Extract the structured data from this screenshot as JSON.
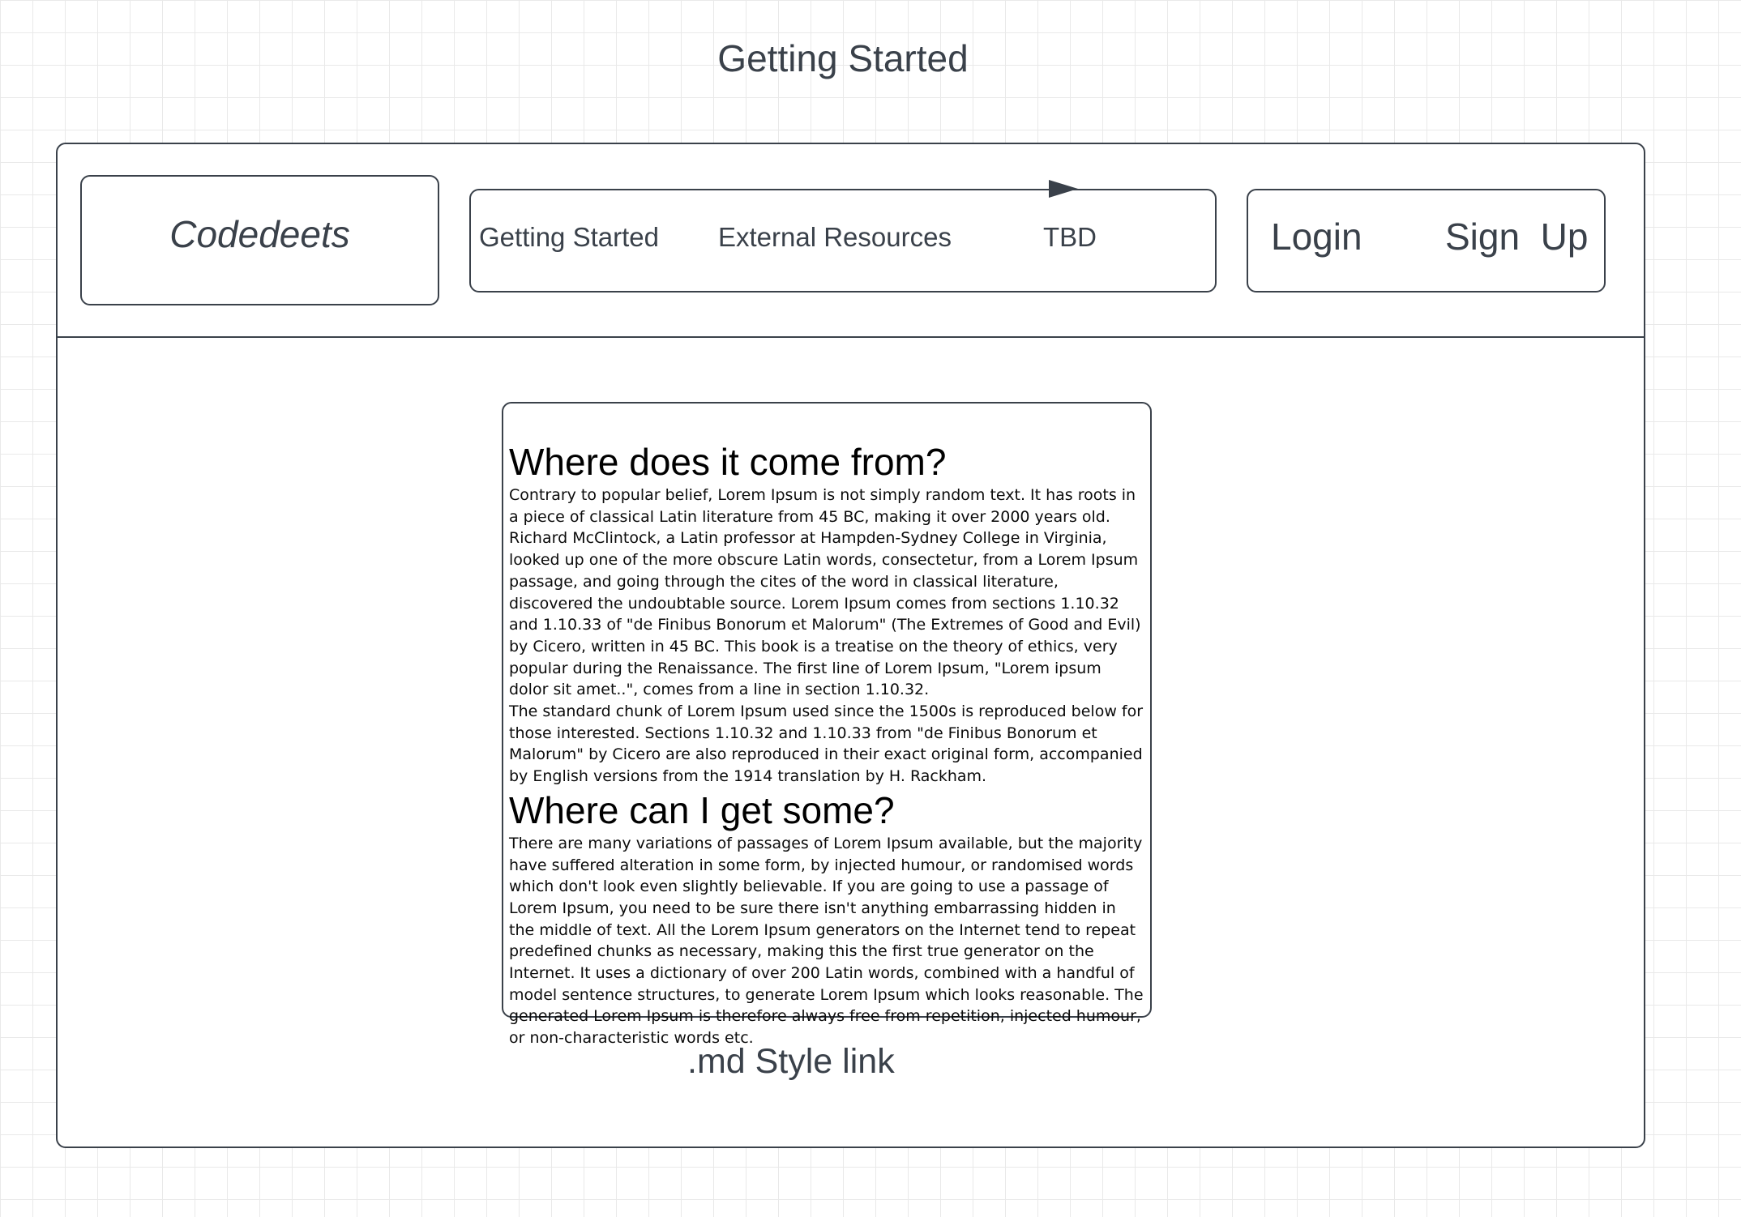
{
  "page_title": "Getting Started",
  "header": {
    "logo": "Codedeets",
    "nav": {
      "items": [
        "Getting Started",
        "External Resources",
        "TBD"
      ]
    },
    "auth": {
      "login": "Login",
      "signup": "Sign  Up"
    }
  },
  "content": {
    "sections": [
      {
        "heading": "Where does it come from?",
        "paragraphs": [
          "Contrary to popular belief, Lorem Ipsum is not simply random text. It has roots in a piece of classical Latin literature from 45 BC, making it over 2000 years old. Richard McClintock, a Latin professor at Hampden-Sydney College in Virginia, looked up one of the more obscure Latin words, consectetur, from a Lorem Ipsum passage, and going through the cites of the word in classical literature, discovered the undoubtable source. Lorem Ipsum comes from sections 1.10.32 and 1.10.33 of \"de Finibus Bonorum et Malorum\" (The Extremes of Good and Evil) by Cicero, written in 45 BC. This book is a treatise on the theory of ethics, very popular during the Renaissance. The first line of Lorem Ipsum, \"Lorem ipsum dolor sit amet..\", comes from a line in section 1.10.32.",
          "The standard chunk of Lorem Ipsum used since the 1500s is reproduced below for those interested. Sections 1.10.32 and 1.10.33 from \"de Finibus Bonorum et Malorum\" by Cicero are also reproduced in their exact original form, accompanied by English versions from the 1914 translation by H. Rackham."
        ]
      },
      {
        "heading": "Where can I get some?",
        "paragraphs": [
          "There are many variations of passages of Lorem Ipsum available, but the majority have suffered alteration in some form, by injected humour, or randomised words which don't look even slightly believable. If you are going to use a passage of Lorem Ipsum, you need to be sure there isn't anything embarrassing hidden in the middle of text. All the Lorem Ipsum generators on the Internet tend to repeat predefined chunks as necessary, making this the first true generator on the Internet. It uses a dictionary of over 200 Latin words, combined with a handful of model sentence structures, to generate Lorem Ipsum which looks reasonable. The generated Lorem Ipsum is therefore always free from repetition, injected humour, or non-characteristic words etc."
        ]
      }
    ]
  },
  "md_link": ".md Style link"
}
